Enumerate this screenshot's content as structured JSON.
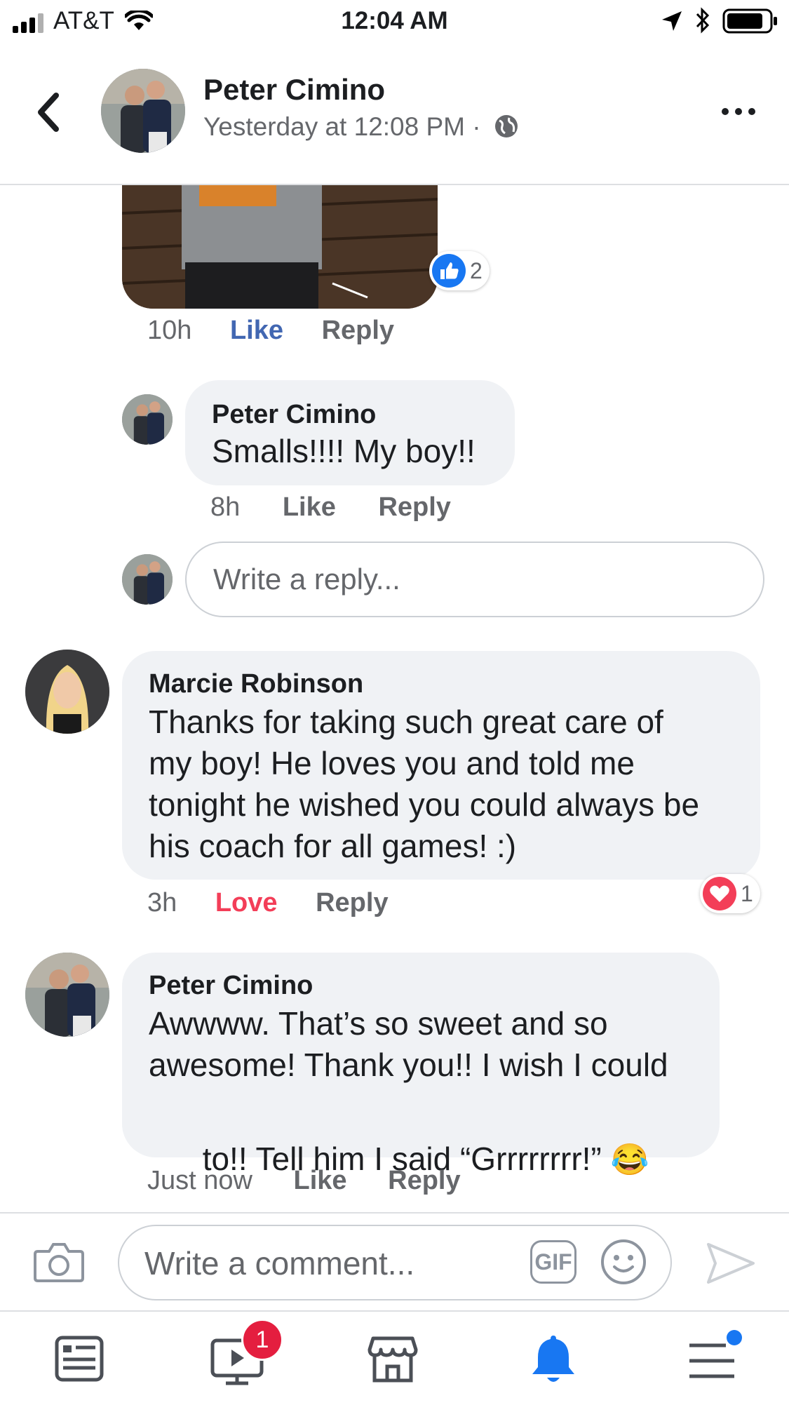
{
  "status_bar": {
    "carrier": "AT&T",
    "time": "12:04 AM"
  },
  "header": {
    "author": "Peter Cimino",
    "timestamp": "Yesterday at 12:08 PM · ",
    "privacy_icon": "globe-icon",
    "more_icon": "more-dots-icon",
    "back_icon": "back-chevron-icon"
  },
  "photo_comment": {
    "reaction_count": "2",
    "time": "10h",
    "like_label": "Like",
    "reply_label": "Reply"
  },
  "reply_1": {
    "name": "Peter Cimino",
    "text": "Smalls!!!! My boy!!",
    "time": "8h",
    "like_label": "Like",
    "reply_label": "Reply"
  },
  "reply_input": {
    "placeholder": "Write a reply..."
  },
  "comment_marcie": {
    "name": "Marcie Robinson",
    "lines": [
      "Thanks for taking such great care of",
      "my boy! He loves you and told me",
      "tonight he wished you could always be",
      "his coach for all games! :)"
    ],
    "time": "3h",
    "love_label": "Love",
    "reply_label": "Reply",
    "reaction_count": "1"
  },
  "comment_peter": {
    "name": "Peter Cimino",
    "lines": [
      "Awwww.  That’s so sweet and so",
      "awesome! Thank you!! I wish I could",
      "to!! Tell him I said “Grrrrrrrr!” "
    ],
    "emoji": "😂",
    "time": "Just now",
    "like_label": "Like",
    "reply_label": "Reply"
  },
  "comment_composer": {
    "placeholder": "Write a comment...",
    "gif_label": "GIF"
  },
  "tab_bar": {
    "video_badge": "1"
  },
  "colors": {
    "facebook_blue": "#1877f2",
    "like_blue": "#4267b2",
    "love_red": "#f33e58",
    "secondary_text": "#65676b",
    "bubble_gray": "#f0f2f5"
  }
}
